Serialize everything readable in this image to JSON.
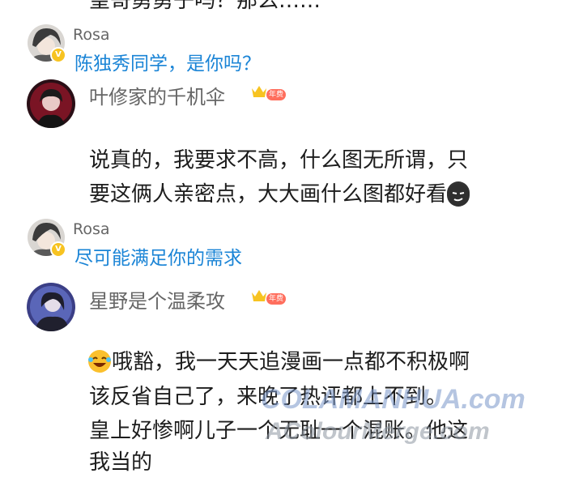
{
  "top_text": "皇哥勇勇子吗？那么……",
  "comments": [
    {
      "reply_name": "Rosa",
      "reply_text": "陈独秀同学，是你吗？"
    },
    {
      "username": "叶修家的千机伞",
      "badge": "年费",
      "lines": [
        "说真的，我要求不高，什么图无所谓，只",
        "要这俩人亲密点，大大画什么图都好看"
      ]
    },
    {
      "reply_name": "Rosa",
      "reply_text": "尽可能满足你的需求"
    },
    {
      "username": "星野是个温柔攻",
      "badge": "年费",
      "lines": [
        "哦豁，我一天天追漫画一点都不积极啊",
        "该反省自己了，来晚了热评都上不到。",
        "皇上好惨啊儿子一个无耻一个混账。他这",
        "我当的"
      ]
    }
  ],
  "verified_mark": "V",
  "watermark_top": "COLAMANHUA.com",
  "watermark_bottom": "AColourMerge.com",
  "colors": {
    "link": "#1a84d6",
    "crown": "#f7c321",
    "badge": "#ff6e5d"
  }
}
